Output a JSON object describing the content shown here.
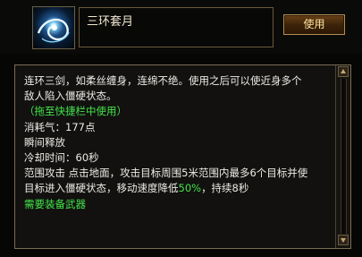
{
  "skill": {
    "name": "三环套月",
    "icon": "blue-spiral-skill-icon"
  },
  "actions": {
    "use_label": "使用"
  },
  "description": {
    "line1": "连环三剑，如柔丝缠身，连绵不绝。使用之后可以使近身多个",
    "line2": "敌人陷入僵硬状态。",
    "hint": "（拖至快捷栏中使用）",
    "cost": "消耗气：177点",
    "cast": "瞬间释放",
    "cooldown": "冷却时间：60秒",
    "effect1": "范围攻击 点击地面，攻击目标周围5米范围内最多6个目标并使",
    "effect2_prefix": "目标进入僵硬状态，移动速度降低",
    "effect2_highlight": "50%",
    "effect2_suffix": "，持续8秒",
    "requirement": "需要装备武器"
  },
  "colors": {
    "highlight": "#43e54a",
    "button_text": "#ffe3a1",
    "border": "#7a6d54"
  }
}
